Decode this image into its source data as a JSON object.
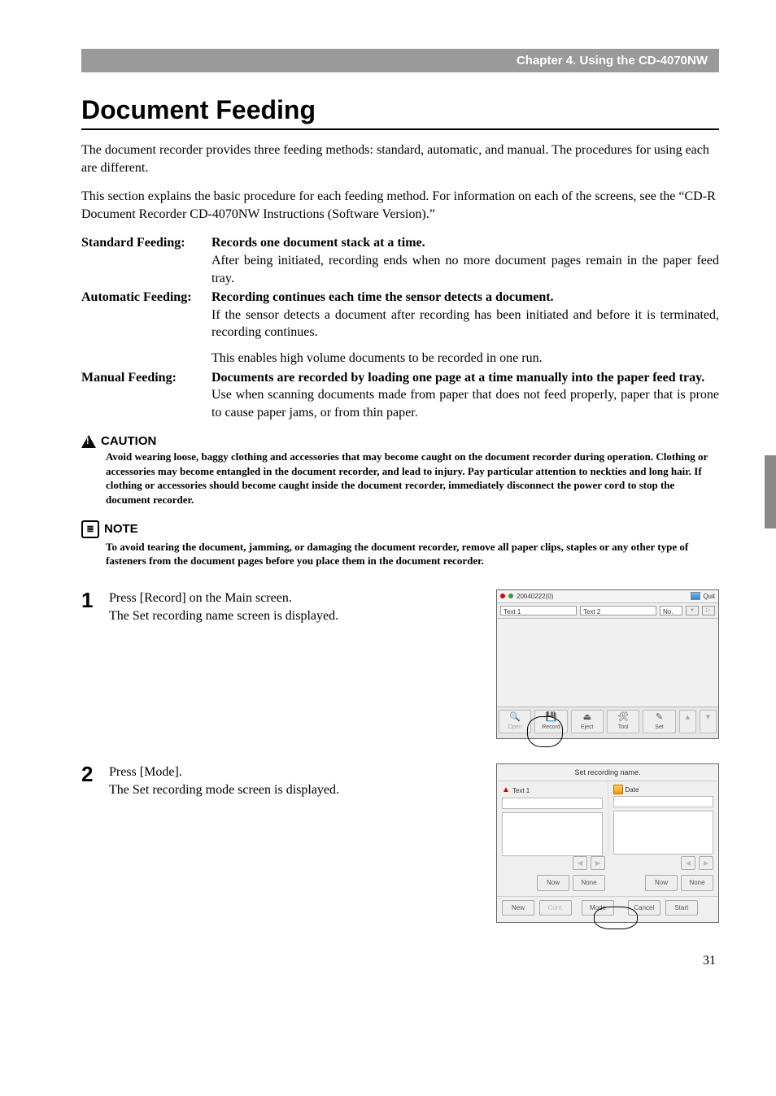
{
  "chapter": "Chapter 4. Using the CD-4070NW",
  "title": "Document Feeding",
  "intro1": "The document recorder provides three feeding methods: standard, automatic, and manual. The procedures for using each are different.",
  "intro2": "This section explains the basic procedure for each feeding method. For information on each of the screens, see the “CD-R Document Recorder CD-4070NW Instructions (Software Version).”",
  "feeding": {
    "standard": {
      "label": "Standard Feeding:",
      "head": "Records one document stack at a time.",
      "body": "After being initiated, recording ends when no more document pages remain in the paper feed tray."
    },
    "automatic": {
      "label": "Automatic Feeding:",
      "head": "Recording continues each time the sensor detects a document.",
      "body1": "If the sensor detects a document after recording has been initiated and before it is terminated, recording continues.",
      "body2": "This enables high volume documents to be recorded in one run."
    },
    "manual": {
      "label": "Manual Feeding:",
      "head": "Documents are recorded by loading one page at a time manually into the paper feed tray.",
      "body": "Use when scanning documents made from paper that does not feed properly, paper that is prone to cause paper jams, or from thin paper."
    }
  },
  "caution": {
    "title": "CAUTION",
    "body": "Avoid wearing loose, baggy clothing and accessories that may become caught on the document recorder during operation. Clothing or accessories may become entangled in the document recorder, and lead to injury. Pay particular attention to neckties and long hair. If clothing or accessories should become caught inside the document recorder, immediately disconnect the power cord to stop the document recorder."
  },
  "note": {
    "title": "NOTE",
    "body": "To avoid tearing the document, jamming, or damaging the document recorder, remove all paper clips, staples or any other type of fasteners from the document pages before you place them in the document recorder."
  },
  "steps": {
    "s1": {
      "num": "1",
      "line1": "Press [Record] on the Main screen.",
      "line2": "The Set recording name screen is displayed."
    },
    "s2": {
      "num": "2",
      "line1": "Press [Mode].",
      "line2": "The Set recording mode screen is displayed."
    }
  },
  "mainscreen": {
    "id": "20040222(0)",
    "quit": "Quit",
    "text1": "Text 1",
    "text2": "Text 2",
    "no": "No.",
    "arrow": "▷",
    "btn_open": "Open",
    "btn_record": "Record",
    "btn_eject": "Eject",
    "btn_tool": "Tool",
    "btn_set": "Set"
  },
  "setrec": {
    "title": "Set recording name.",
    "text1": "Text 1",
    "date": "Date",
    "tri_left": "◀",
    "tri_right": "▶",
    "btn_now": "Now",
    "btn_none": "None",
    "btn_new": "New",
    "btn_cont": "Cont.",
    "btn_mode": "Mode",
    "btn_cancel": "Cancel",
    "btn_start": "Start"
  },
  "page_number": "31"
}
